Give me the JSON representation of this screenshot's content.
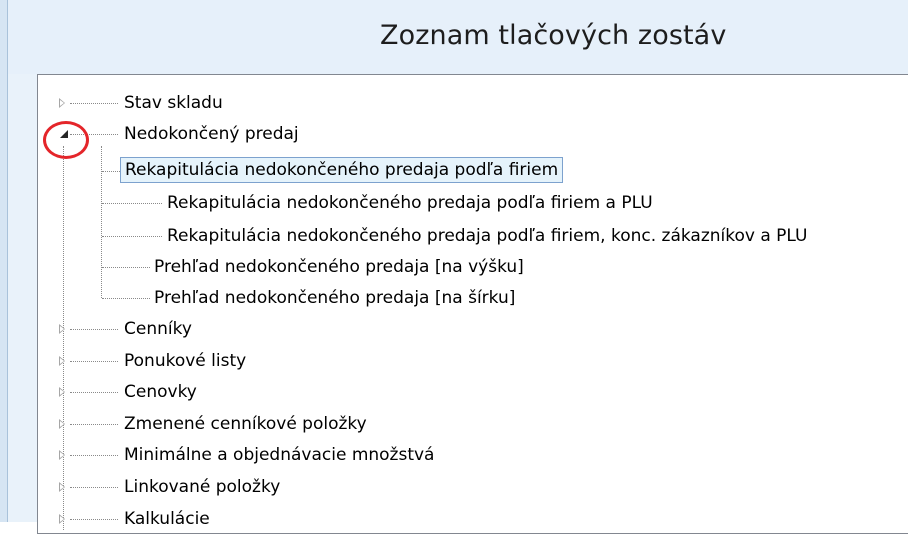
{
  "window": {
    "title": "Zoznam tlačových zostáv"
  },
  "tree": {
    "items": [
      {
        "label": "Stav skladu",
        "expanded": false
      },
      {
        "label": "Nedokončený predaj",
        "expanded": true,
        "children": [
          {
            "label": "Rekapitulácia nedokončeného predaja podľa firiem",
            "selected": true
          },
          {
            "label": "Rekapitulácia nedokončeného predaja podľa firiem a PLU"
          },
          {
            "label": "Rekapitulácia nedokončeného predaja podľa firiem, konc. zákazníkov a PLU"
          },
          {
            "label": "Prehľad nedokončeného predaja [na výšku]"
          },
          {
            "label": "Prehľad nedokončeného predaja [na šírku]"
          }
        ]
      },
      {
        "label": "Cenníky",
        "expanded": false
      },
      {
        "label": "Ponukové listy",
        "expanded": false
      },
      {
        "label": "Cenovky",
        "expanded": false
      },
      {
        "label": "Zmenené cenníkové položky",
        "expanded": false
      },
      {
        "label": "Minimálne a objednávacie množstvá",
        "expanded": false
      },
      {
        "label": "Linkované položky",
        "expanded": false
      },
      {
        "label": "Kalkulácie",
        "expanded": false
      }
    ]
  },
  "annotation": {
    "highlight_color": "#e4252a"
  }
}
